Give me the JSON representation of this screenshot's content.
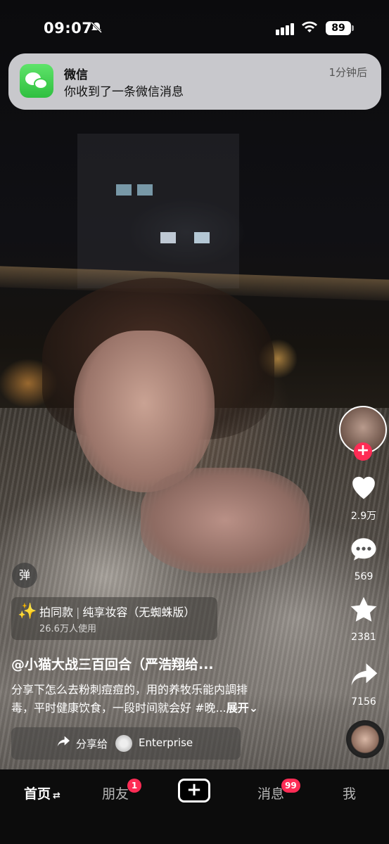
{
  "status_bar": {
    "time": "09:07",
    "battery": "89",
    "mute_icon": "bell-slash-icon",
    "signal_icon": "cellular-signal-icon",
    "wifi_icon": "wifi-icon"
  },
  "notification": {
    "app_name": "微信",
    "message": "你收到了一条微信消息",
    "time": "1分钟后",
    "icon": "wechat-icon"
  },
  "rail": {
    "like_count": "2.9万",
    "comment_count": "569",
    "favorite_count": "2381",
    "share_count": "7156",
    "follow_symbol": "+"
  },
  "video_info": {
    "danmu_label": "弹",
    "sticker_title": "拍同款",
    "sticker_name": "纯享妆容（无蜘蛛版）",
    "sticker_users": "26.6万人使用",
    "author": "@小猫大战三百回合（严浩翔给...",
    "desc_line1": "分享下怎么去粉刺痘痘的，用的养牧乐能内調排",
    "desc_line2": "毒，平时健康饮食，一段时间就会好 #晚...",
    "more_label": "展开⌄"
  },
  "share_bar": {
    "label": "分享给",
    "name": "Enterprise"
  },
  "nav": {
    "home": "首页",
    "home_suffix": "⇄",
    "friends": "朋友",
    "friends_badge": "1",
    "plus": "+",
    "messages": "消息",
    "messages_badge": "99",
    "me": "我"
  },
  "colors": {
    "accent_red": "#fe2c55",
    "wechat_green": "#2fbf3f"
  }
}
